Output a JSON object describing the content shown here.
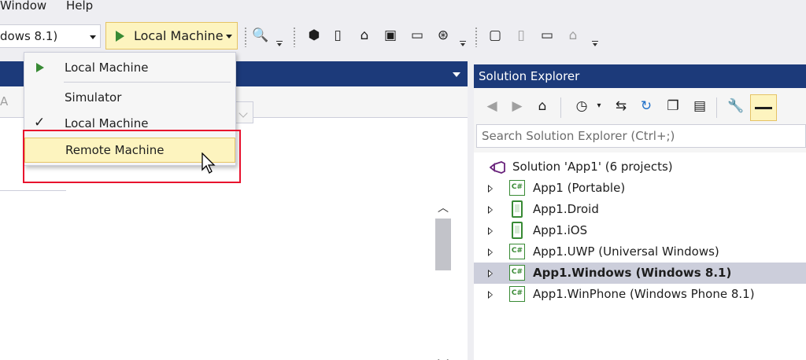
{
  "menubar": {
    "items": [
      "Window",
      "Help"
    ]
  },
  "toolbar": {
    "platform_combo_value": "dows 8.1)",
    "run_button_label": "Local Machine",
    "icons": [
      "find-icon",
      "device-icon",
      "phone-icon",
      "robot-icon",
      "console-icon",
      "tablet-icon",
      "globe-icon",
      "monitor-icon",
      "phone-disabled-icon",
      "tablet-icon",
      "robot-disabled-icon"
    ]
  },
  "left_panel": {
    "sub_label": "A"
  },
  "dropdown": {
    "items": [
      {
        "label": "Local Machine",
        "icon": "play-icon"
      },
      {
        "label": "Simulator"
      },
      {
        "label": "Local Machine",
        "checked": true
      },
      {
        "label": "Remote Machine",
        "highlighted": true
      }
    ]
  },
  "solution_explorer": {
    "title": "Solution Explorer",
    "search_placeholder": "Search Solution Explorer (Ctrl+;)",
    "solution": "Solution 'App1' (6 projects)",
    "projects": [
      {
        "label": "App1 (Portable)",
        "icon": "csharp-project-icon"
      },
      {
        "label": "App1.Droid",
        "icon": "phone-project-icon"
      },
      {
        "label": "App1.iOS",
        "icon": "phone-project-icon"
      },
      {
        "label": "App1.UWP (Universal Windows)",
        "icon": "csharp-project-icon"
      },
      {
        "label": "App1.Windows (Windows 8.1)",
        "icon": "csharp-project-icon",
        "selected": true,
        "bold": true
      },
      {
        "label": "App1.WinPhone (Windows Phone 8.1)",
        "icon": "csharp-project-icon"
      }
    ],
    "project_icon_text": "C#"
  },
  "colors": {
    "accent_header": "#1c3a7a",
    "highlight": "#fdf4bf",
    "highlight_border": "#e5c365",
    "run_green": "#388a34",
    "red_annotation": "#e8112d"
  }
}
